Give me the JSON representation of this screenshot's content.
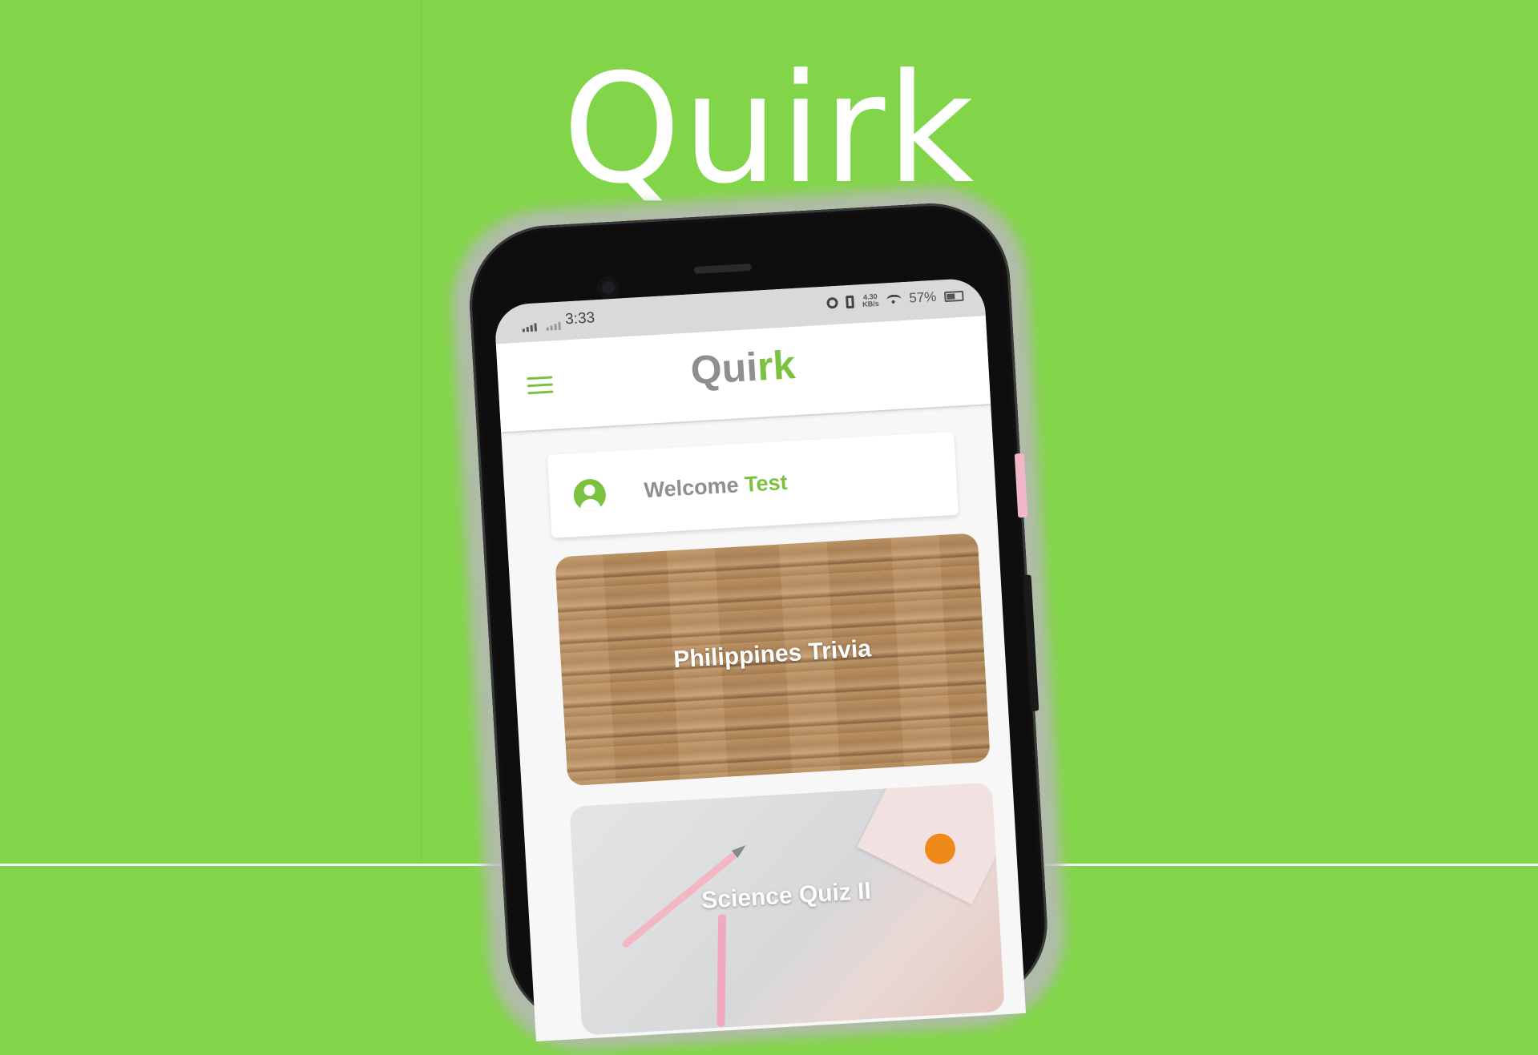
{
  "hero": {
    "title": "Quirk"
  },
  "status_bar": {
    "time": "3:33",
    "net_speed_value": "4.30",
    "net_speed_unit": "KB/s",
    "battery": "57%"
  },
  "app_bar": {
    "logo_part1": "Qui",
    "logo_part2": "rk"
  },
  "welcome": {
    "greeting": "Welcome",
    "user_name": "Test"
  },
  "quizzes": [
    {
      "title": "Philippines Trivia"
    },
    {
      "title": "Science Quiz II"
    }
  ],
  "colors": {
    "background": "#82d548",
    "accent": "#7cc242",
    "logo_gray": "#8f8f8f"
  },
  "icons": [
    "menu-icon",
    "user-avatar-icon",
    "alarm-icon",
    "vibrate-icon",
    "wifi-icon",
    "battery-icon",
    "signal-icon"
  ]
}
